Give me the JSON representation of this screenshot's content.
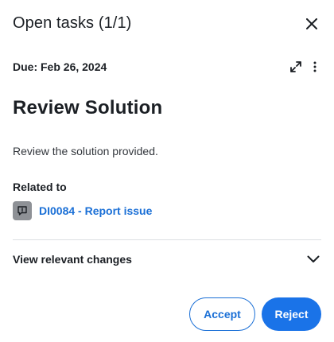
{
  "header": {
    "title": "Open tasks (1/1)"
  },
  "task": {
    "due": "Due: Feb 26, 2024",
    "title": "Review Solution",
    "description": "Review the solution provided.",
    "related_label": "Related to",
    "related_link": "DI0084 - Report issue",
    "changes_label": "View relevant changes"
  },
  "actions": {
    "accept_label": "Accept",
    "reject_label": "Reject"
  },
  "icons": {
    "close": "close-icon",
    "expand": "expand-icon",
    "more": "more-vertical-icon",
    "issue": "report-issue-icon",
    "chevron": "chevron-down-icon"
  },
  "colors": {
    "accent": "#1a73e8",
    "link": "#1a6fd6",
    "text": "#1b1f24",
    "divider": "#dcdfe3",
    "icon_bg": "#8e9196"
  }
}
